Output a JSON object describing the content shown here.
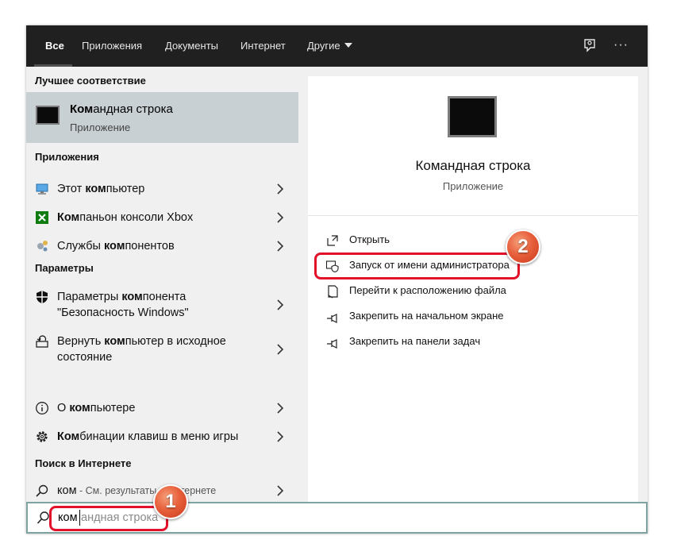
{
  "tabs": [
    {
      "label": "Все",
      "active": true
    },
    {
      "label": "Приложения"
    },
    {
      "label": "Документы"
    },
    {
      "label": "Интернет"
    },
    {
      "label": "Другие"
    }
  ],
  "top_icons": [
    "feedback-icon",
    "more-icon"
  ],
  "more_label": "···",
  "sections": {
    "best": "Лучшее соответствие",
    "apps": "Приложения",
    "settings": "Параметры",
    "web": "Поиск в Интернете"
  },
  "best_match": {
    "title_bold": "Ком",
    "title_rest": "андная строка",
    "subtitle": "Приложение",
    "icon": "cmd-icon"
  },
  "apps": [
    {
      "pre": "Этот ",
      "bold": "ком",
      "post": "пьютер",
      "icon": "computer-icon"
    },
    {
      "pre": "",
      "bold": "Ком",
      "post": "паньон консоли Xbox",
      "icon": "xbox-icon"
    },
    {
      "pre": "Службы ",
      "bold": "ком",
      "post": "понентов",
      "icon": "services-icon"
    }
  ],
  "settings": [
    {
      "line1_pre": "Параметры ",
      "line1_bold": "ком",
      "line1_post": "понента",
      "line2": "\"Безопасность Windows\"",
      "icon": "shield-icon"
    },
    {
      "line1_pre": "Вернуть ",
      "line1_bold": "ком",
      "line1_post": "пьютер в исходное",
      "line2": "состояние",
      "icon": "reset-pc-icon"
    },
    {
      "line1_pre": "О ",
      "line1_bold": "ком",
      "line1_post": "пьютере",
      "line2": "",
      "icon": "info-icon"
    },
    {
      "line1_pre": "",
      "line1_bold": "Ком",
      "line1_post": "бинации клавиш в меню игры",
      "line2": "",
      "icon": "gear-icon"
    }
  ],
  "web_result": {
    "query": "ком",
    "hint": " - См. результаты в Интернете",
    "icon": "search-icon"
  },
  "preview": {
    "title": "Командная строка",
    "subtitle": "Приложение"
  },
  "actions": [
    {
      "label": "Открыть",
      "icon": "open-icon"
    },
    {
      "label": "Запуск от имени администратора",
      "icon": "run-as-admin-icon"
    },
    {
      "label": "Перейти к расположению файла",
      "icon": "file-location-icon"
    },
    {
      "label": "Закрепить на начальном экране",
      "icon": "pin-icon"
    },
    {
      "label": "Закрепить на панели задач",
      "icon": "pin-icon"
    }
  ],
  "search": {
    "typed": "ком",
    "suggestion": "андная строка"
  },
  "annotations": {
    "step1": "1",
    "step2": "2"
  },
  "colors": {
    "topbar": "#202020",
    "selected": "#c9d0d3",
    "highlight": "#e3122a",
    "badge": "#e8603c"
  }
}
